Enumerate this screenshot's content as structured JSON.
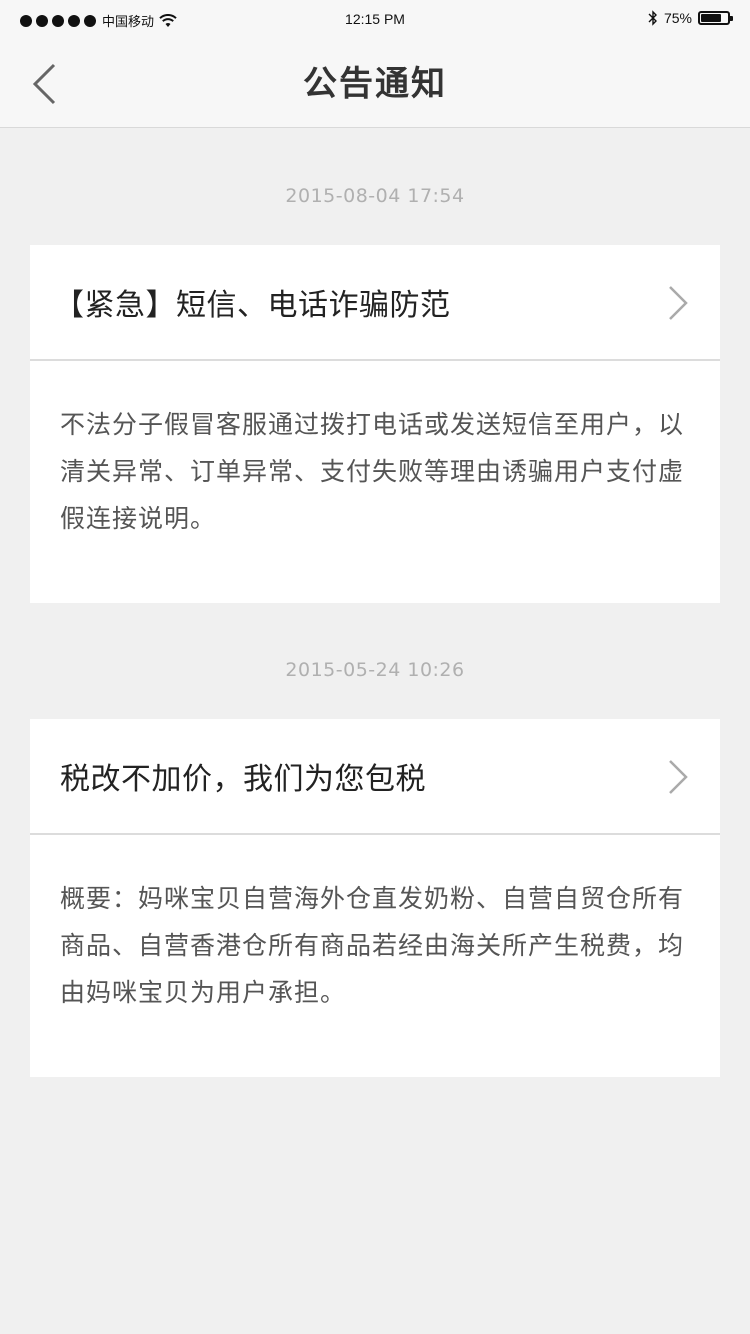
{
  "status_bar": {
    "carrier": "中国移动",
    "time": "12:15 PM",
    "battery_percent_label": "75%",
    "battery_level": 0.75
  },
  "nav": {
    "title": "公告通知",
    "back_icon": "chevron-left-icon"
  },
  "notices": [
    {
      "date": "2015-08-04 17:54",
      "title": "【紧急】短信、电话诈骗防范",
      "body": "不法分子假冒客服通过拨打电话或发送短信至用户，以清关异常、订单异常、支付失败等理由诱骗用户支付虚假连接说明。"
    },
    {
      "date": "2015-05-24 10:26",
      "title": "税改不加价，我们为您包税",
      "body": "概要：妈咪宝贝自营海外仓直发奶粉、自营自贸仓所有商品、自营香港仓所有商品若经由海关所产生税费，均由妈咪宝贝为用户承担。"
    }
  ],
  "colors": {
    "background": "#f0f0f0",
    "card": "#ffffff",
    "timestamp": "#b0b0b0",
    "divider": "#dcdcdc"
  }
}
